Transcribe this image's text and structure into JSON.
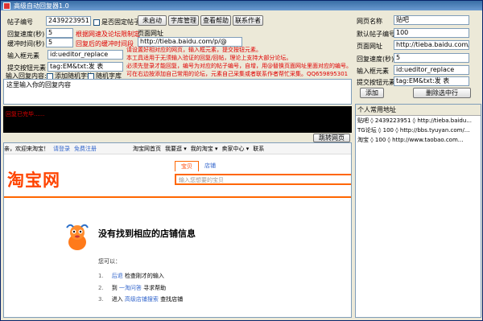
{
  "window": {
    "title": "高级自动回复器1.0"
  },
  "left": {
    "post_id_label": "帖子编号",
    "post_id_value": "2439223951",
    "fixed_post_label": "是否固定帖子",
    "reply_interval_label": "回复速度(秒)",
    "reply_interval_value": "5",
    "reply_interval_hint": "根据网速及论坛限制定",
    "buffer_label": "缓冲时间(秒)",
    "buffer_value": "5",
    "buffer_hint": "回复后的缓冲时间段",
    "page_url_label": "页面网址",
    "page_url_value": "http://tieba.baidu.com/p/@",
    "input_box_label": "输入框元素",
    "input_box_value": "id:ueditor_replace",
    "submit_label": "提交按钮元素",
    "submit_value": "tag:EM&txt:发 表",
    "reply_content_label": "输入回复内容:",
    "random_char_label": "添加随机字符",
    "random_lib_label": "随机字库",
    "editor_text": "这里输入你的回复内容",
    "console_text": "回复已完毕......",
    "jump_button": "跳转网页"
  },
  "buttons": {
    "start": "未启动",
    "library": "字库管理",
    "help": "查看帮助",
    "contact": "联系作者"
  },
  "notes": [
    "请设置好相对应的网页，输入框元素，提交按钮元素。",
    "本工具适用于无须输入验证的回复/回帖，理论上支持大部分论坛。",
    "必须先登录才能回复，编号为对应的帖子编号，自增，用@替换页面网址里面对应的编号。",
    "可在右边按添加自己常用的论坛，元素自己采集或者联系作者帮忙采集。QQ659895301"
  ],
  "right": {
    "web_name_label": "网页名称",
    "web_name_value": "贴吧",
    "default_id_label": "默认帖子编号",
    "default_id_value": "100",
    "page_url_label": "页面网址",
    "page_url_value": "http://tieba.baidu.com/p/@",
    "reply_speed_label": "回复速度(秒)",
    "reply_speed_value": "5",
    "input_box_label": "输入框元素",
    "input_box_value": "id:ueditor_replace",
    "submit_label": "提交按钮元素",
    "submit_value": "tag:EM&txt:发 表",
    "add_button": "添加",
    "delete_button": "删除选中行",
    "list_header": "个人常用地址",
    "list": [
      "贴吧 ◊ 2439223951 ◊ http://tieba.baidu...",
      "TG论坛 ◊ 100 ◊ http://bbs.tyuyan.com/...",
      "淘宝 ◊ 100 ◊ http://www.taobao.com..."
    ]
  },
  "browser": {
    "top_left": "亲，欢迎来淘宝！",
    "login": "请登录",
    "register": "免费注册",
    "nav": [
      "淘宝网首页",
      "我要逛 ▾",
      "我的淘宝 ▾",
      "卖家中心 ▾",
      "联系"
    ],
    "logo": "淘宝网",
    "tab_baby": "宝贝",
    "tab_shop": "店铺",
    "search_placeholder": "输入您想要的宝贝",
    "not_found": "没有找到相应的店铺信息",
    "you_can": "您可以：",
    "steps": [
      {
        "num": "1.",
        "link": "后退",
        "text": " 检查刚才的输入"
      },
      {
        "num": "2.",
        "link": "一淘问答",
        "pre": "到 ",
        "text": " 寻求帮助"
      },
      {
        "num": "3.",
        "link": "高级店铺搜索",
        "pre": "进入 ",
        "text": " 查找店铺"
      }
    ]
  },
  "colors": {
    "accent": "#ff6600",
    "notes": "#e00000",
    "titlebar": "#3a6ea5"
  }
}
